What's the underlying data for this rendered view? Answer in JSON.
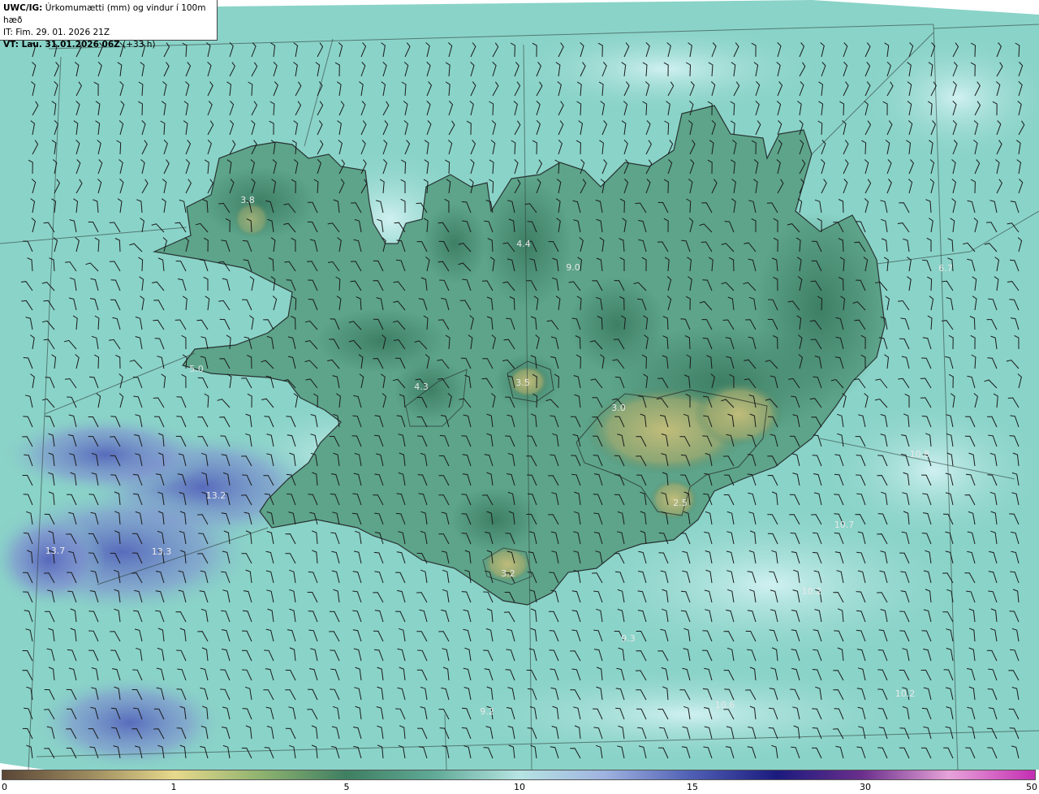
{
  "info": {
    "title_bold": "UWC/IG:",
    "title_rest": "Úrkomumætti (mm) og vindur í 100m hæð",
    "it": "IT: Fim. 29. 01. 2026 21Z",
    "vt_bold": "VT: Lau. 31.01.2026 06Z",
    "vt_rest": "(+33 h)"
  },
  "colorbar": {
    "ticks": [
      "0",
      "1",
      "5",
      "10",
      "15",
      "30",
      "50"
    ],
    "colors": [
      "#5a4636",
      "#9b8a5e",
      "#e7d98c",
      "#8fb36f",
      "#3f7f62",
      "#5fa996",
      "#b6e4e2",
      "#9fb3e0",
      "#4f5fb4",
      "#1b1b7e",
      "#6b2f8c",
      "#e7a3d9",
      "#c42db2"
    ]
  },
  "map": {
    "colors": {
      "sea": "#8ad3c8",
      "land_dark": "#3c7d62",
      "land_yellow": "#b2b473",
      "blue_patch": "#6d7fc8",
      "light_patch": "#c6ecee"
    },
    "values": [
      {
        "t": "3.8"
      },
      {
        "t": "4.4"
      },
      {
        "t": "6.7"
      },
      {
        "t": "9.0"
      },
      {
        "t": "5.0"
      },
      {
        "t": "4.3"
      },
      {
        "t": "3.5"
      },
      {
        "t": "3.0"
      },
      {
        "t": "2.5"
      },
      {
        "t": "3.2"
      },
      {
        "t": "13.2"
      },
      {
        "t": "13.7"
      },
      {
        "t": "13.3"
      },
      {
        "t": "10.7"
      },
      {
        "t": "10.8"
      },
      {
        "t": "10.2"
      },
      {
        "t": "9.3"
      },
      {
        "t": "10.6"
      },
      {
        "t": "9.2"
      },
      {
        "t": "10.2"
      }
    ]
  }
}
